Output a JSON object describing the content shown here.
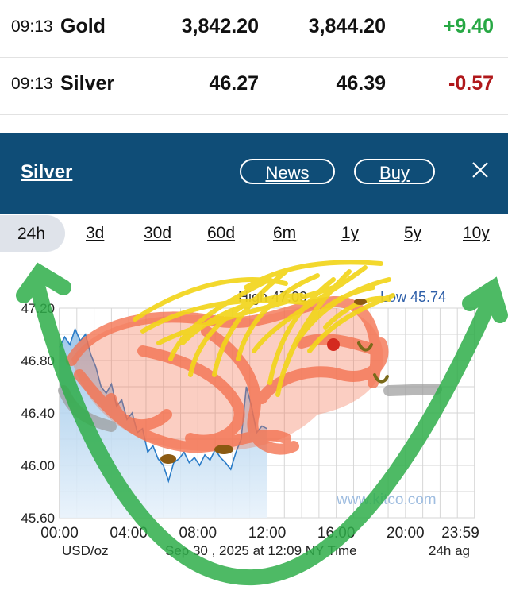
{
  "quotes": [
    {
      "time": "09:13",
      "name": "Gold",
      "bid": "3,842.20",
      "ask": "3,844.20",
      "change": "+9.40",
      "direction": "up"
    },
    {
      "time": "09:13",
      "name": "Silver",
      "bid": "46.27",
      "ask": "46.39",
      "change": "-0.57",
      "direction": "down"
    }
  ],
  "header": {
    "title": "Silver",
    "news_label": "News",
    "buy_label": "Buy",
    "close_icon": "close-icon",
    "background": "#0f4d77"
  },
  "tabs": [
    "24h",
    "3d",
    "30d",
    "60d",
    "6m",
    "1y",
    "5y",
    "10y"
  ],
  "active_tab": "24h",
  "chart_data": {
    "type": "line",
    "high_label": "High 47.09",
    "low_label": "Low 45.74",
    "y_ticks": [
      "47.20",
      "46.80",
      "46.40",
      "46.00",
      "45.60"
    ],
    "ylim": [
      45.6,
      47.2
    ],
    "x_ticks": [
      "00:00",
      "04:00",
      "08:00",
      "12:00",
      "16:00",
      "20:00",
      "23:59"
    ],
    "unit_label": "USD/oz",
    "date_label": "Sep 30 , 2025 at 12:09 NY Time",
    "period_label": "24h ag",
    "watermark": "www.kitco.com",
    "series": [
      {
        "x": [
          0,
          0.3,
          0.6,
          0.9,
          1.2,
          1.5,
          1.8,
          2.1,
          2.4,
          2.7,
          3.0,
          3.3,
          3.6,
          3.9,
          4.2,
          4.5,
          4.8,
          5.1,
          5.4,
          5.7,
          6.0,
          6.3,
          6.6,
          6.9,
          7.2,
          7.5,
          7.8,
          8.1,
          8.4,
          8.7,
          9.0,
          9.3,
          9.6,
          9.9,
          10.2,
          10.5,
          10.8,
          11.1,
          11.4,
          11.7,
          12.0
        ],
        "y": [
          46.9,
          46.98,
          46.92,
          47.04,
          46.95,
          47.0,
          46.85,
          46.75,
          46.6,
          46.55,
          46.62,
          46.45,
          46.5,
          46.35,
          46.4,
          46.25,
          46.28,
          46.1,
          46.15,
          46.05,
          46.0,
          45.88,
          46.02,
          46.05,
          46.1,
          46.02,
          46.06,
          46.0,
          46.08,
          46.04,
          46.12,
          46.06,
          46.02,
          45.97,
          46.1,
          46.2,
          46.6,
          46.45,
          46.25,
          46.3,
          46.28
        ]
      }
    ],
    "doodle_colors": {
      "hair": "#f2d51c",
      "body": "#f4724f",
      "arrow": "#2fae4a",
      "spots": "#8b5a12"
    }
  }
}
